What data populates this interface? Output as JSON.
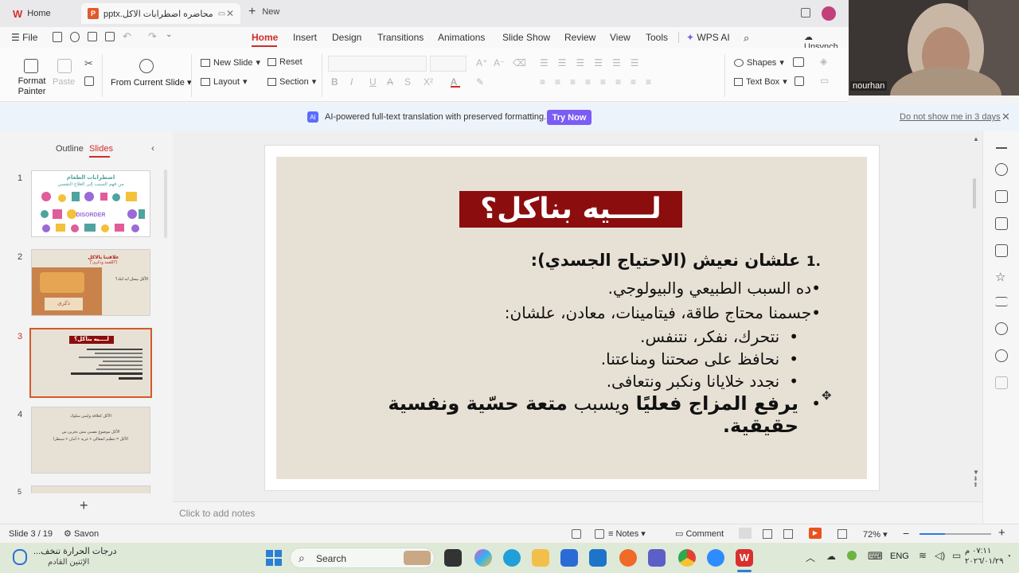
{
  "tabs": {
    "home": "Home",
    "document": "محاضره اضطرابات الاكل.pptx",
    "new": "New"
  },
  "menu": {
    "file": "File",
    "items": [
      "Home",
      "Insert",
      "Design",
      "Transitions",
      "Animations",
      "Slide Show",
      "Review",
      "View",
      "Tools"
    ],
    "wps_ai": "WPS AI",
    "sync": "Unsynch"
  },
  "ribbon": {
    "format_painter": "Format Painter",
    "paste": "Paste",
    "from_current_slide": "From Current Slide",
    "new_slide": "New  Slide",
    "reset": "Reset",
    "layout": "Layout",
    "section": "Section",
    "shapes": "Shapes",
    "text_box": "Text Box"
  },
  "notification": {
    "message": "AI-powered full-text translation with preserved formatting.",
    "try_now": "Try Now",
    "dismiss": "Do not show me in 3 days"
  },
  "video": {
    "participant": "nourhan"
  },
  "panel": {
    "outline_tab": "Outline",
    "slides_tab": "Slides",
    "slide_numbers": [
      "1",
      "2",
      "3",
      "4",
      "5"
    ],
    "thumb1_title": "اضطرابات الطعام",
    "thumb1_subtitle": "من فهم السبب إلى العلاج النفسي",
    "thumb1_word": "DISORDER",
    "thumb2_title": "علاقتنا بالاكل",
    "thumb2_sub": "(\"اللقمة وذكرى\")",
    "thumb2_body": "الأكل بيمثل ايه ليك؟",
    "thumb2_card": "ذكرى",
    "thumb3_title": "لــــيه بناكل؟",
    "thumb4_line1": "الأكل كعلاقة وليس سلوك",
    "thumb4_line2": "الأكل موضوع نفسي مش تخزين س",
    "thumb4_line3": "الأكل = تنظيم انفعالي + غرية + أمان + سيطرا"
  },
  "slide": {
    "title": "لــــيه بناكل؟",
    "heading": "علشان نعيش (الاحتياج الجسدي):",
    "heading_num": "1.",
    "bullet1": "ده السبب الطبيعي والبيولوجي.",
    "bullet2": "جسمنا محتاج طاقة، فيتامينات، معادن، علشان:",
    "sub1": "نتحرك، نفكر، نتنفس.",
    "sub2": "نحافظ على صحتنا ومناعتنا.",
    "sub3": "نجدد خلايانا ونكبر ونتعافى.",
    "sub4_bold_a": "يرفع المزاج فعليًا",
    "sub4_mid": " ويسبب ",
    "sub4_bold_b": "متعة حسّية ونفسية حقيقية."
  },
  "notes": {
    "placeholder": "Click to add notes"
  },
  "status": {
    "slide_counter": "Slide 3 / 19",
    "theme": "Savon",
    "notes": "Notes",
    "comment": "Comment",
    "zoom": "72%"
  },
  "taskbar": {
    "weather_title": "درجات الحرارة تنخف...",
    "weather_sub": "الإثنين القادم",
    "search": "Search",
    "lang": "ENG",
    "time": "٠٧:١١ م",
    "date": "٢٠٢٦/٠١/٢٩"
  },
  "colors": {
    "accent_red": "#d12b2b",
    "slide_title_bg": "#8b0d0d",
    "slide_bg": "#e7e1d5",
    "try_now": "#7b5cf5",
    "taskbar": "#dfe9d8"
  }
}
